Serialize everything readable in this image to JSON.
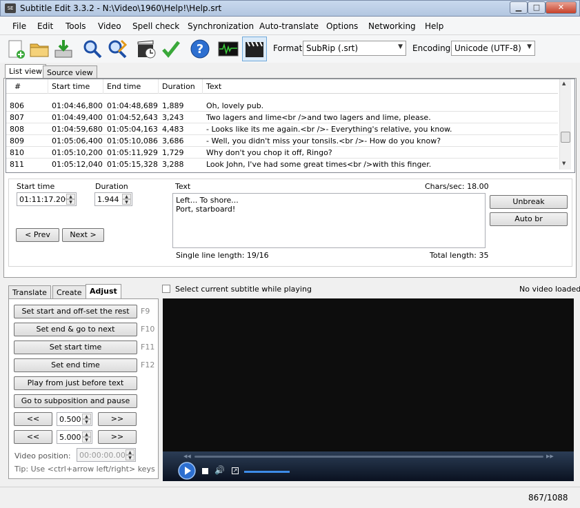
{
  "window": {
    "title": "Subtitle Edit 3.3.2 - N:\\Video\\1960\\Help!\\Help.srt",
    "icon_label": "SE",
    "minimize": "▁",
    "maximize": "□",
    "close": "✕"
  },
  "menu": [
    "File",
    "Edit",
    "Tools",
    "Video",
    "Spell check",
    "Synchronization",
    "Auto-translate",
    "Options",
    "Networking",
    "Help"
  ],
  "toolbar": {
    "format_label": "Format",
    "format_value": "SubRip (.srt)",
    "encoding_label": "Encoding",
    "encoding_value": "Unicode (UTF-8)",
    "icons": [
      "new-file-icon",
      "open-folder-icon",
      "save-download-icon",
      "find-magnifier-icon",
      "replace-magnifier-icon",
      "visual-sync-clapper-icon",
      "spell-check-icon",
      "help-icon",
      "waveform-icon",
      "video-clapper-icon"
    ]
  },
  "view_tabs": [
    "List view",
    "Source view"
  ],
  "list": {
    "columns": [
      "#",
      "Start time",
      "End time",
      "Duration",
      "Text"
    ],
    "rows": [
      [
        "806",
        "01:04:46,800",
        "01:04:48,689",
        "1,889",
        "Oh, lovely pub."
      ],
      [
        "807",
        "01:04:49,400",
        "01:04:52,643",
        "3,243",
        "Two lagers and lime<br />and two lagers and lime, please."
      ],
      [
        "808",
        "01:04:59,680",
        "01:05:04,163",
        "4,483",
        "- Looks like its me again.<br />- Everything's relative, you know."
      ],
      [
        "809",
        "01:05:06,400",
        "01:05:10,086",
        "3,686",
        "- Well, you didn't miss your tonsils.<br />- How do you know?"
      ],
      [
        "810",
        "01:05:10,200",
        "01:05:11,929",
        "1,729",
        "Why don't you chop it off, Ringo?"
      ],
      [
        "811",
        "01:05:12,040",
        "01:05:15,328",
        "3,288",
        "Look John, I've had some great times<br />with this finger."
      ]
    ]
  },
  "editor": {
    "start_time_label": "Start time",
    "start_time_value": "01:11:17.200",
    "duration_label": "Duration",
    "duration_value": "1.944",
    "text_label": "Text",
    "chars_sec": "Chars/sec: 18.00",
    "text_value": "Left... To shore...\nPort, starboard!",
    "prev_button": "< Prev",
    "next_button": "Next >",
    "unbreak_button": "Unbreak",
    "auto_br_button": "Auto br",
    "single_line_length": "Single line length:  19/16",
    "total_length": "Total length: 35"
  },
  "bottom_tabs": [
    "Translate",
    "Create",
    "Adjust"
  ],
  "select_while_playing": "Select current subtitle while playing",
  "no_video": "No video loaded",
  "adjust": {
    "buttons": [
      {
        "label": "Set start and off-set the rest",
        "key": "F9"
      },
      {
        "label": "Set end & go to next",
        "key": "F10"
      },
      {
        "label": "Set start time",
        "key": "F11"
      },
      {
        "label": "Set end time",
        "key": "F12"
      },
      {
        "label": "Play from just before text",
        "key": ""
      },
      {
        "label": "Go to subposition and pause",
        "key": ""
      }
    ],
    "back_label": "<<",
    "fwd_label": ">>",
    "step1": "0.500",
    "step2": "5.000",
    "video_position_label": "Video position:",
    "video_position_value": "00:00:00.000",
    "tip": "Tip: Use <ctrl+arrow left/right> keys"
  },
  "status": {
    "position": "867/1088"
  }
}
